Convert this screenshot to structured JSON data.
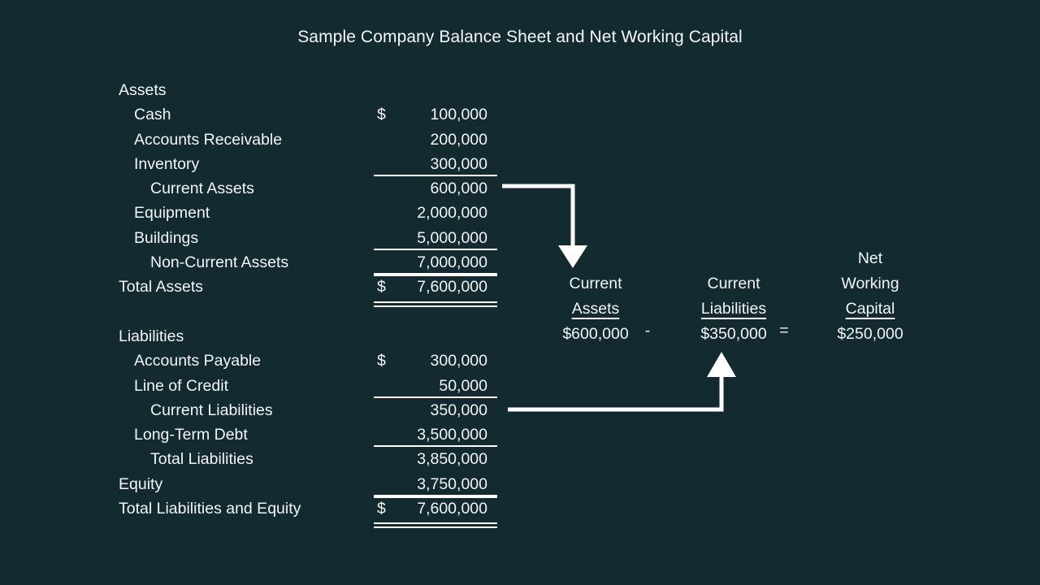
{
  "title": "Sample Company Balance Sheet and Net Working Capital",
  "colors": {
    "background": "#132a30",
    "text": "#f2f6f7",
    "rule": "#ffffff",
    "arrow": "#ffffff"
  },
  "balance_sheet": {
    "currency_symbol": "$",
    "rows": [
      {
        "label": "Assets",
        "indent": 0,
        "currency": "",
        "amount": "",
        "rules": ""
      },
      {
        "label": "Cash",
        "indent": 1,
        "currency": "$",
        "amount": "100,000",
        "rules": ""
      },
      {
        "label": "Accounts Receivable",
        "indent": 1,
        "currency": "",
        "amount": "200,000",
        "rules": ""
      },
      {
        "label": "Inventory",
        "indent": 1,
        "currency": "",
        "amount": "300,000",
        "rules": "bottom"
      },
      {
        "label": "Current Assets",
        "indent": 2,
        "currency": "",
        "amount": "600,000",
        "rules": ""
      },
      {
        "label": "Equipment",
        "indent": 1,
        "currency": "",
        "amount": "2,000,000",
        "rules": ""
      },
      {
        "label": "Buildings",
        "indent": 1,
        "currency": "",
        "amount": "5,000,000",
        "rules": "bottom"
      },
      {
        "label": "Non-Current Assets",
        "indent": 2,
        "currency": "",
        "amount": "7,000,000",
        "rules": "bottom"
      },
      {
        "label": "Total Assets",
        "indent": 0,
        "currency": "$",
        "amount": "7,600,000",
        "rules": "double"
      },
      {
        "label": "",
        "indent": 0,
        "currency": "",
        "amount": "",
        "rules": ""
      },
      {
        "label": "Liabilities",
        "indent": 0,
        "currency": "",
        "amount": "",
        "rules": ""
      },
      {
        "label": "Accounts Payable",
        "indent": 1,
        "currency": "$",
        "amount": "300,000",
        "rules": ""
      },
      {
        "label": "Line of Credit",
        "indent": 1,
        "currency": "",
        "amount": "50,000",
        "rules": "bottom"
      },
      {
        "label": "Current Liabilities",
        "indent": 2,
        "currency": "",
        "amount": "350,000",
        "rules": ""
      },
      {
        "label": "Long-Term Debt",
        "indent": 1,
        "currency": "",
        "amount": "3,500,000",
        "rules": "bottom"
      },
      {
        "label": "Total Liabilities",
        "indent": 2,
        "currency": "",
        "amount": "3,850,000",
        "rules": ""
      },
      {
        "label": "Equity",
        "indent": 0,
        "currency": "",
        "amount": "3,750,000",
        "rules": "bottom"
      },
      {
        "label": "Total Liabilities and Equity",
        "indent": 0,
        "currency": "$",
        "amount": "7,600,000",
        "rules": "double"
      }
    ]
  },
  "net_working_capital": {
    "current_assets": {
      "line1": "Current",
      "line2": "Assets",
      "line3": "",
      "value": "$600,000"
    },
    "current_liabilities": {
      "line1": "Current",
      "line2": "Liabilities",
      "line3": "",
      "value": "$350,000"
    },
    "net_working_capital": {
      "line1": "Net",
      "line2": "Working",
      "line3": "Capital",
      "value": "$250,000"
    },
    "operator_minus": "-",
    "operator_equals": "="
  },
  "arrows": [
    {
      "name": "current-assets-to-formula",
      "direction": "down"
    },
    {
      "name": "current-liabilities-to-formula",
      "direction": "up"
    }
  ]
}
